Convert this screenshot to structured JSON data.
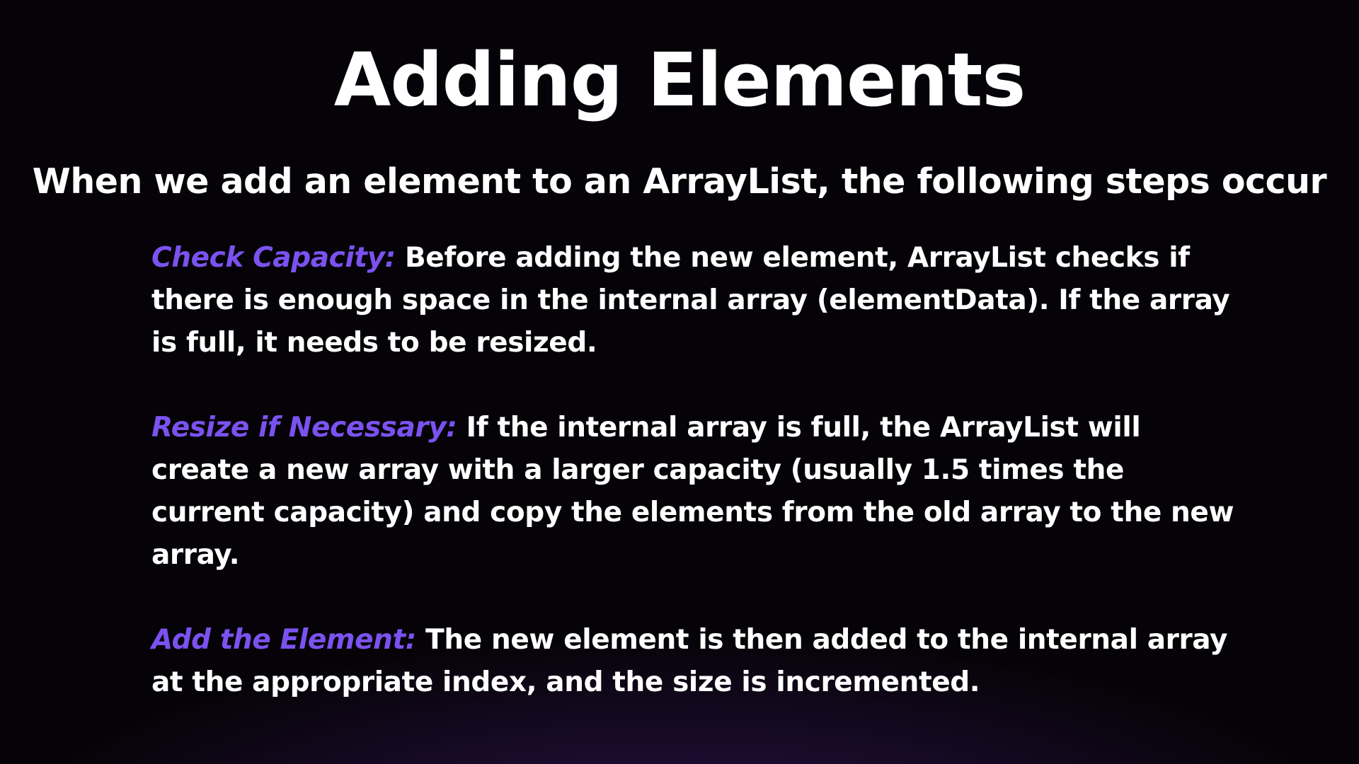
{
  "title": "Adding Elements",
  "subtitle": "When we add an element to an ArrayList, the following steps occur",
  "accent_color": "#7b52f0",
  "steps": [
    {
      "term": "Check Capacity:",
      "text": "Before adding the new element, ArrayList checks if there is enough space in the internal array (elementData). If the array is full, it needs to be resized."
    },
    {
      "term": "Resize if Necessary:",
      "text": "If the internal array is full, the ArrayList will create a new array with a larger capacity (usually 1.5 times the current capacity) and copy the elements from the old array to the new array."
    },
    {
      "term": "Add the Element:",
      "text": "The new element is then added to the internal array at the appropriate index, and the size is incremented."
    }
  ]
}
